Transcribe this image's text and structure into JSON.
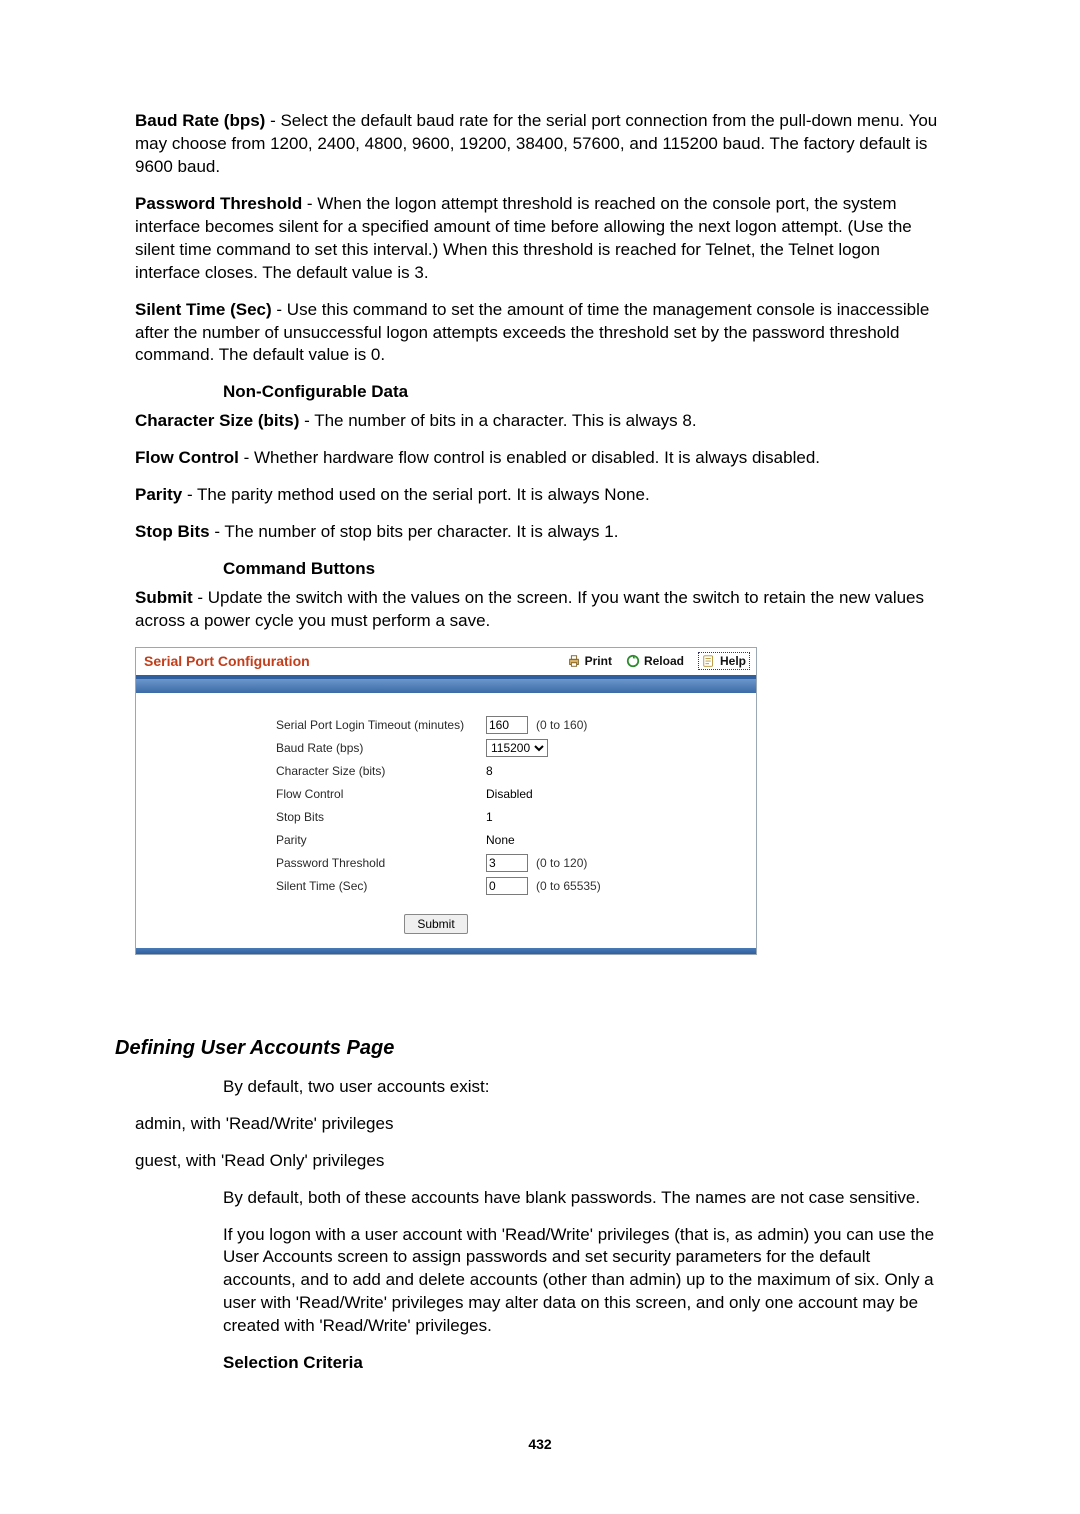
{
  "doc": {
    "params": {
      "baud": {
        "label": "Baud Rate (bps)",
        "text": " - Select the default baud rate for the serial port connection from the pull-down menu. You may choose from 1200, 2400, 4800, 9600, 19200, 38400, 57600, and 115200 baud. The factory default is 9600 baud."
      },
      "pwthresh": {
        "label": "Password Threshold",
        "text": " - When the logon attempt threshold is reached on the console port, the system interface becomes silent for a specified amount of time before allowing the next logon attempt. (Use the silent time command to set this interval.) When this threshold is reached for Telnet, the Telnet logon interface closes. The default value is 3."
      },
      "silent": {
        "label": "Silent Time (Sec)",
        "text": " - Use this command to set the amount of time the management console is inaccessible after the number of unsuccessful logon attempts exceeds the threshold set by the password threshold command. The default value is 0."
      }
    },
    "noncfg_heading": "Non-Configurable Data",
    "noncfg": {
      "charsize": {
        "label": "Character Size (bits)",
        "text": " - The number of bits in a character. This is always 8."
      },
      "flow": {
        "label": "Flow Control",
        "text": " - Whether hardware flow control is enabled or disabled. It is always disabled."
      },
      "parity": {
        "label": "Parity",
        "text": " - The parity method used on the serial port. It is always None."
      },
      "stop": {
        "label": "Stop Bits",
        "text": " - The number of stop bits per character. It is always 1."
      }
    },
    "cmd_heading": "Command Buttons",
    "submit_desc": {
      "label": "Submit",
      "text": " - Update the switch with the values on the screen. If you want the switch to retain the new values across a power cycle you must perform a save."
    }
  },
  "panel": {
    "title": "Serial Port Configuration",
    "actions": {
      "print": "Print",
      "reload": "Reload",
      "help": "Help"
    },
    "rows": {
      "timeout": {
        "label": "Serial Port Login Timeout (minutes)",
        "value": "160",
        "hint": "(0 to 160)"
      },
      "baud": {
        "label": "Baud Rate (bps)",
        "value": "115200"
      },
      "char": {
        "label": "Character Size (bits)",
        "value": "8"
      },
      "flow": {
        "label": "Flow Control",
        "value": "Disabled"
      },
      "stop": {
        "label": "Stop Bits",
        "value": "1"
      },
      "parity": {
        "label": "Parity",
        "value": "None"
      },
      "pwth": {
        "label": "Password Threshold",
        "value": "3",
        "hint": "(0 to 120)"
      },
      "silent": {
        "label": "Silent Time (Sec)",
        "value": "0",
        "hint": "(0 to 65535)"
      }
    },
    "submit": "Submit"
  },
  "section2": {
    "title": "Defining User Accounts Page",
    "p1": "By default, two user accounts exist:",
    "p2": "admin, with 'Read/Write' privileges",
    "p3": "guest, with 'Read Only' privileges",
    "p4": "By default, both of these accounts have blank passwords. The names are not case sensitive.",
    "p5": "If you logon with a user account with 'Read/Write' privileges (that is, as admin) you can use the User Accounts screen to assign passwords and set security parameters for the default accounts, and to add and delete accounts (other than admin) up to the maximum of six. Only a user with 'Read/Write' privileges may alter data on this screen, and only one account may be created with 'Read/Write' privileges.",
    "selcrit": "Selection Criteria"
  },
  "page_number": "432"
}
